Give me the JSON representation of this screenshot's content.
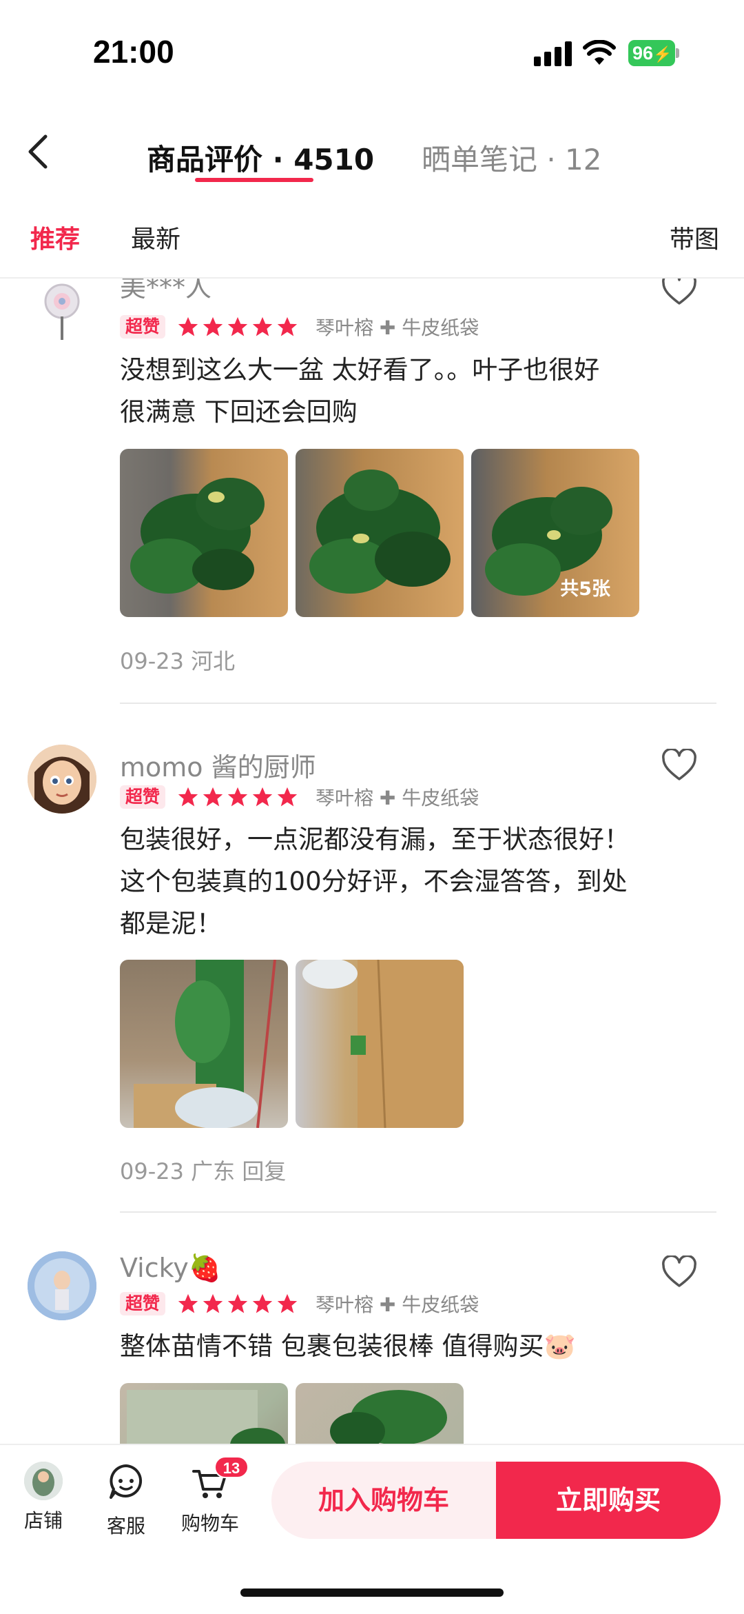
{
  "status_bar": {
    "time": "21:00",
    "battery": "96"
  },
  "header": {
    "tabs": [
      {
        "label": "商品评价 · 4510",
        "active": true
      },
      {
        "label": "晒单笔记 · 12",
        "active": false
      }
    ]
  },
  "filters": {
    "recommended": "推荐",
    "latest": "最新",
    "with_images": "带图"
  },
  "reviews": [
    {
      "username": "美***人",
      "badge": "超赞",
      "stars": 5,
      "variant": "琴叶榕 ✚ 牛皮纸袋",
      "comment": "没想到这么大一盆 太好看了。。叶子也很好 很满意 下回还会回购",
      "photo_count": "共5张",
      "meta": "09-23 河北"
    },
    {
      "username": "momo 酱的厨师",
      "badge": "超赞",
      "stars": 5,
      "variant": "琴叶榕 ✚ 牛皮纸袋",
      "comment": "包装很好，一点泥都没有漏，至于状态很好！这个包装真的100分好评，不会湿答答，到处都是泥！",
      "meta": "09-23 广东 回复"
    },
    {
      "username": "Vicky🍓",
      "badge": "超赞",
      "stars": 5,
      "variant": "琴叶榕 ✚ 牛皮纸袋",
      "comment": "整体苗情不错 包裹包装很棒 值得购买🐷"
    }
  ],
  "bottom_bar": {
    "store": "店铺",
    "service": "客服",
    "cart": "购物车",
    "cart_count": "13",
    "add_to_cart": "加入购物车",
    "buy_now": "立即购买"
  },
  "colors": {
    "accent": "#f2284c",
    "battery": "#34c759"
  },
  "icons": [
    "back-icon",
    "heart-icon",
    "star-icon",
    "chat-icon",
    "cart-icon",
    "signal-icon",
    "wifi-icon",
    "battery-icon"
  ]
}
